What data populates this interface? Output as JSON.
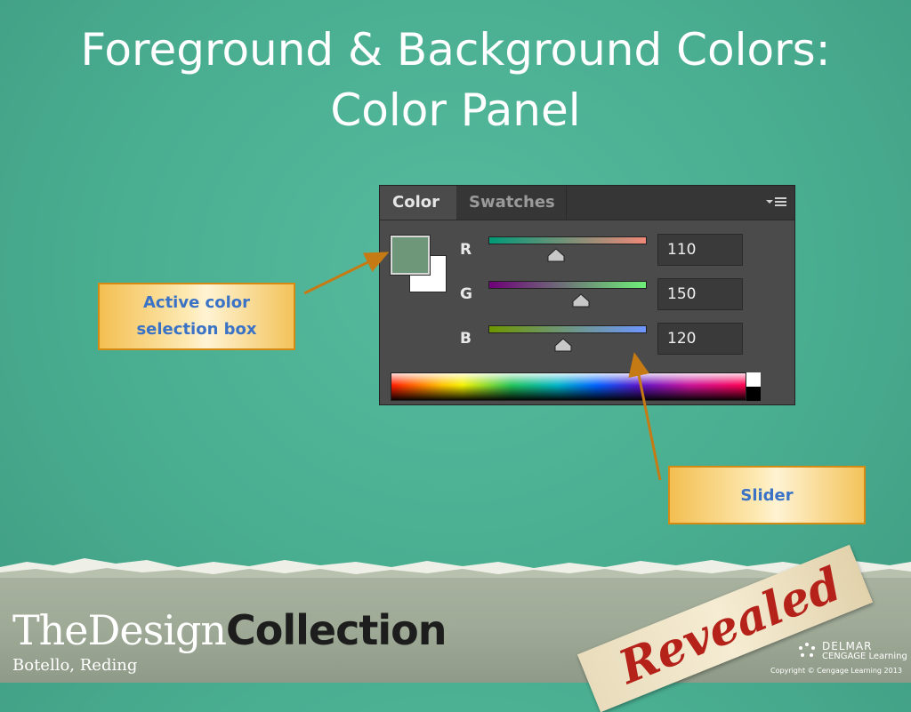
{
  "slide": {
    "title_line1": "Foreground & Background Colors:",
    "title_line2": "Color Panel"
  },
  "color_panel": {
    "tabs": [
      {
        "label": "Color",
        "active": true
      },
      {
        "label": "Swatches",
        "active": false
      }
    ],
    "menu_icon": "panel-menu-icon",
    "foreground_color": "#6e9678",
    "background_color": "#ffffff",
    "channels": [
      {
        "label": "R",
        "value": "110"
      },
      {
        "label": "G",
        "value": "150"
      },
      {
        "label": "B",
        "value": "120"
      }
    ]
  },
  "callouts": {
    "active_color": "Active color selection box",
    "slider": "Slider"
  },
  "footer": {
    "brand_light": "TheDesign",
    "brand_bold": "Collection",
    "authors": "Botello, Reding",
    "revealed": "Revealed",
    "publisher_line1": "DELMAR",
    "publisher_line2": "CENGAGE Learning",
    "copyright": "Copyright © Cengage Learning 2013"
  },
  "colors": {
    "background": "#4ab092",
    "panel": "#4b4b4b",
    "callout_text": "#3a72c6",
    "callout_border": "#d58a12",
    "arrow": "#c57a14"
  }
}
